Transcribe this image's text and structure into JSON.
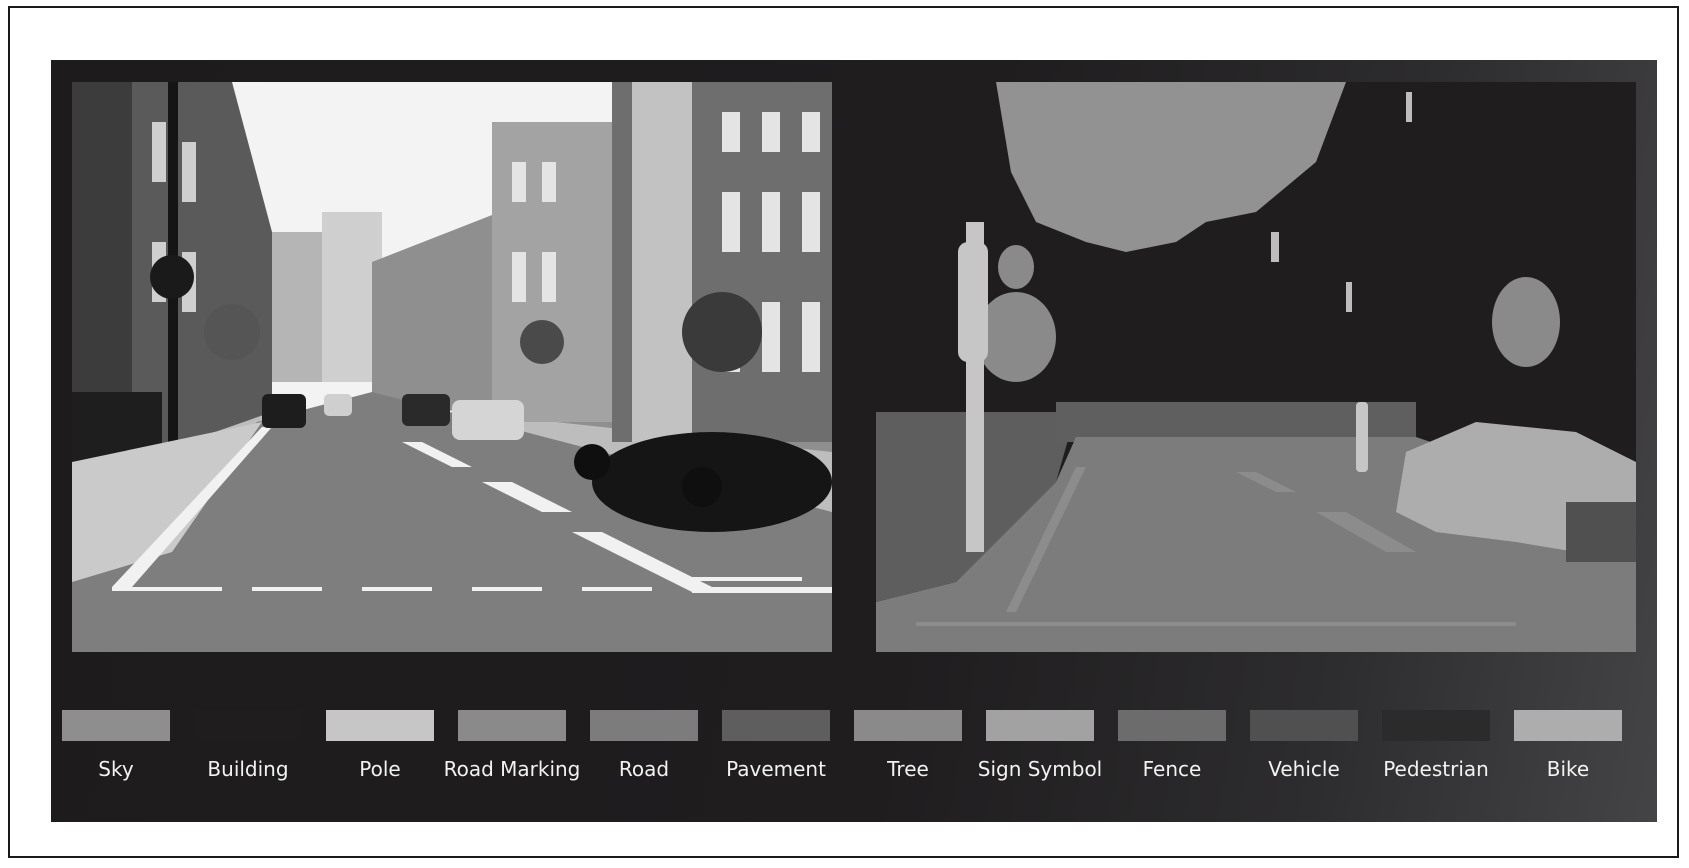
{
  "legend": {
    "items": [
      {
        "label": "Sky",
        "color": "#8e8e8e"
      },
      {
        "label": "Building",
        "color": "#1f1d1e"
      },
      {
        "label": "Pole",
        "color": "#c6c6c6"
      },
      {
        "label": "Road Marking",
        "color": "#8a8a8a"
      },
      {
        "label": "Road",
        "color": "#7c7c7c"
      },
      {
        "label": "Pavement",
        "color": "#5e5e5e"
      },
      {
        "label": "Tree",
        "color": "#8a8a8a"
      },
      {
        "label": "Sign Symbol",
        "color": "#a2a2a2"
      },
      {
        "label": "Fence",
        "color": "#6c6c6c"
      },
      {
        "label": "Vehicle",
        "color": "#505050"
      },
      {
        "label": "Pedestrian",
        "color": "#2c2b2c"
      },
      {
        "label": "Bike",
        "color": "#adadad"
      }
    ]
  },
  "icons": {
    "photo": "street-photo",
    "segmentation": "segmentation-map"
  }
}
